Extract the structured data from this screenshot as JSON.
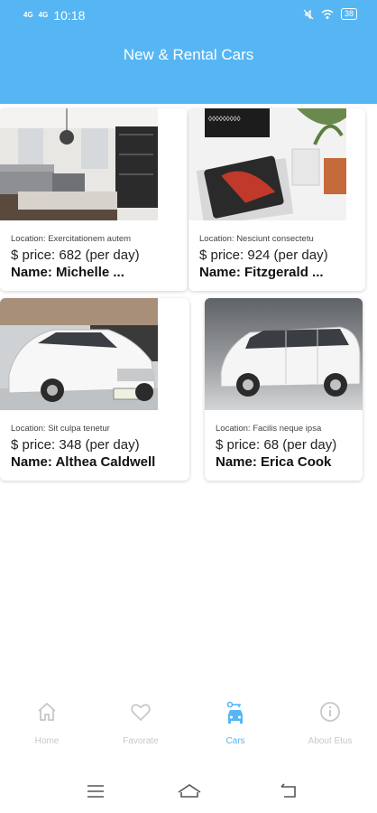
{
  "status_bar": {
    "network_1": "4G",
    "network_2": "4G",
    "time": "10:18",
    "battery": "38"
  },
  "header": {
    "title": "New & Rental Cars"
  },
  "cars": [
    {
      "image": "living-room-interior",
      "location": "Location: Exercitationem autem",
      "price": "$ price: 682 (per day)",
      "name": "Name: Michelle ..."
    },
    {
      "image": "tablet-on-desk",
      "location": "Location: Nesciunt consectetu",
      "price": "$ price: 924 (per day)",
      "name": "Name: Fitzgerald ..."
    },
    {
      "image": "white-sedan",
      "location": "Location: Sit culpa tenetur",
      "price": "$ price: 348 (per day)",
      "name": "Name: Althea Caldwell"
    },
    {
      "image": "white-minivan",
      "location": "Location: Facilis neque ipsa",
      "price": "$ price: 68 (per day)",
      "name": "Name: Erica Cook"
    }
  ],
  "bottom_nav": {
    "items": [
      {
        "label": "Home",
        "icon": "home-icon",
        "active": false
      },
      {
        "label": "Favorate",
        "icon": "heart-icon",
        "active": false
      },
      {
        "label": "Cars",
        "icon": "car-icon",
        "active": true
      },
      {
        "label": "About Etus",
        "icon": "info-icon",
        "active": false
      }
    ]
  },
  "colors": {
    "accent": "#56b6f3",
    "inactive": "#c8c8c8"
  }
}
